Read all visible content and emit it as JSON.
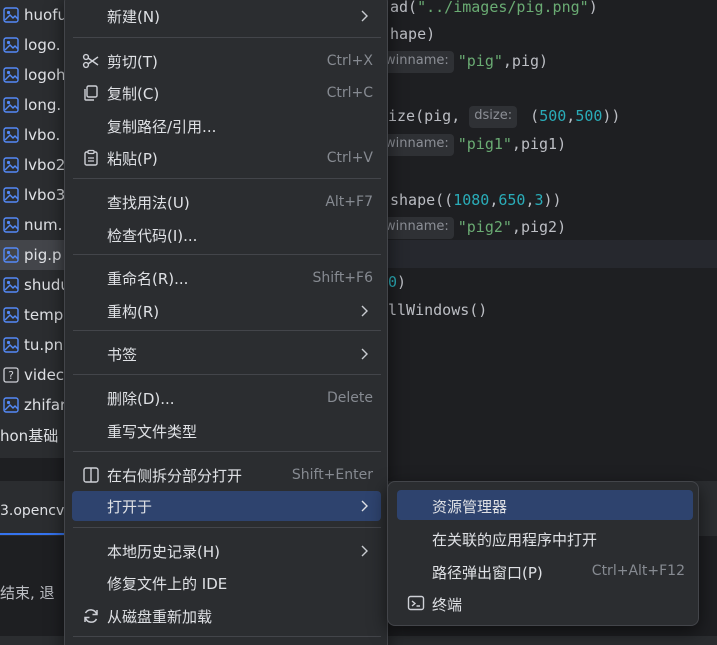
{
  "project_tree": {
    "files": [
      {
        "name": "huofu",
        "icon": "image-file-icon"
      },
      {
        "name": "logo.",
        "icon": "image-file-icon"
      },
      {
        "name": "logoh",
        "icon": "image-file-icon"
      },
      {
        "name": "long.",
        "icon": "image-file-icon"
      },
      {
        "name": "lvbo.",
        "icon": "image-file-icon"
      },
      {
        "name": "lvbo2",
        "icon": "image-file-icon"
      },
      {
        "name": "lvbo3",
        "icon": "image-file-icon"
      },
      {
        "name": "num.",
        "icon": "image-file-icon"
      },
      {
        "name": "pig.p",
        "icon": "image-file-icon",
        "selected": true
      },
      {
        "name": "shudu",
        "icon": "image-file-icon"
      },
      {
        "name": "temp",
        "icon": "image-file-icon"
      },
      {
        "name": "tu.pn",
        "icon": "image-file-icon"
      },
      {
        "name": "videc",
        "icon": "unknown-file-icon"
      },
      {
        "name": "zhifar",
        "icon": "image-file-icon"
      }
    ],
    "folder": "hon基础"
  },
  "editor": {
    "line1_call": "ad(",
    "line1_path": "\"../images/pig.png\"",
    "line1_end": ")",
    "line2": "hape)",
    "line3_hint": "winname:",
    "line3_arg": "\"pig\"",
    "line3_rest": ",pig)",
    "line5_start": "ize(pig, ",
    "line5_hint": "dsize:",
    "line5_open": " (",
    "line5_n1": "500",
    "line5_comma": ",",
    "line5_n2": "500",
    "line5_close": "))",
    "line6_hint": "winname:",
    "line6_arg": "\"pig1\"",
    "line6_rest": ",pig1)",
    "line8_start": "shape((",
    "line8_n1": "1080",
    "line8_c1": ",",
    "line8_n2": "650",
    "line8_c2": ",",
    "line8_n3": "3",
    "line8_close": "))",
    "line9_hint": "winname:",
    "line9_arg": "\"pig2\"",
    "line9_rest": ",pig2)",
    "line11_num": "0",
    "line11_close": ")",
    "line12": "llWindows()"
  },
  "run_panel": {
    "tab_label": "3.opencv",
    "console_text": "结束, 退"
  },
  "context_menu": {
    "new": {
      "label": "新建(N)"
    },
    "cut": {
      "label": "剪切(T)",
      "shortcut": "Ctrl+X",
      "icon": "scissors-icon"
    },
    "copy": {
      "label": "复制(C)",
      "shortcut": "Ctrl+C",
      "icon": "copy-icon"
    },
    "copy_path": {
      "label": "复制路径/引用..."
    },
    "paste": {
      "label": "粘贴(P)",
      "shortcut": "Ctrl+V",
      "icon": "paste-icon"
    },
    "find_usages": {
      "label": "查找用法(U)",
      "shortcut": "Alt+F7"
    },
    "inspect_code": {
      "label": "检查代码(I)..."
    },
    "rename": {
      "label": "重命名(R)...",
      "shortcut": "Shift+F6"
    },
    "refactor": {
      "label": "重构(R)"
    },
    "bookmarks": {
      "label": "书签"
    },
    "delete": {
      "label": "删除(D)...",
      "shortcut": "Delete"
    },
    "override_type": {
      "label": "重写文件类型"
    },
    "open_right_split": {
      "label": "在右侧拆分部分打开",
      "shortcut": "Shift+Enter",
      "icon": "split-right-icon"
    },
    "open_in": {
      "label": "打开于"
    },
    "local_history": {
      "label": "本地历史记录(H)"
    },
    "repair_ide": {
      "label": "修复文件上的 IDE"
    },
    "reload_disk": {
      "label": "从磁盘重新加载",
      "icon": "reload-icon"
    }
  },
  "submenu": {
    "explorer": {
      "label": "资源管理器"
    },
    "associated_app": {
      "label": "在关联的应用程序中打开"
    },
    "path_popup": {
      "label": "路径弹出窗口(P)",
      "shortcut": "Ctrl+Alt+F12"
    },
    "terminal": {
      "label": "终端",
      "icon": "terminal-icon"
    }
  },
  "colors": {
    "accent": "#3574f0",
    "selection": "#2e436e",
    "menu_bg": "#2b2d30",
    "editor_bg": "#1e1f22",
    "string": "#6aab73",
    "number": "#2aacb8"
  }
}
